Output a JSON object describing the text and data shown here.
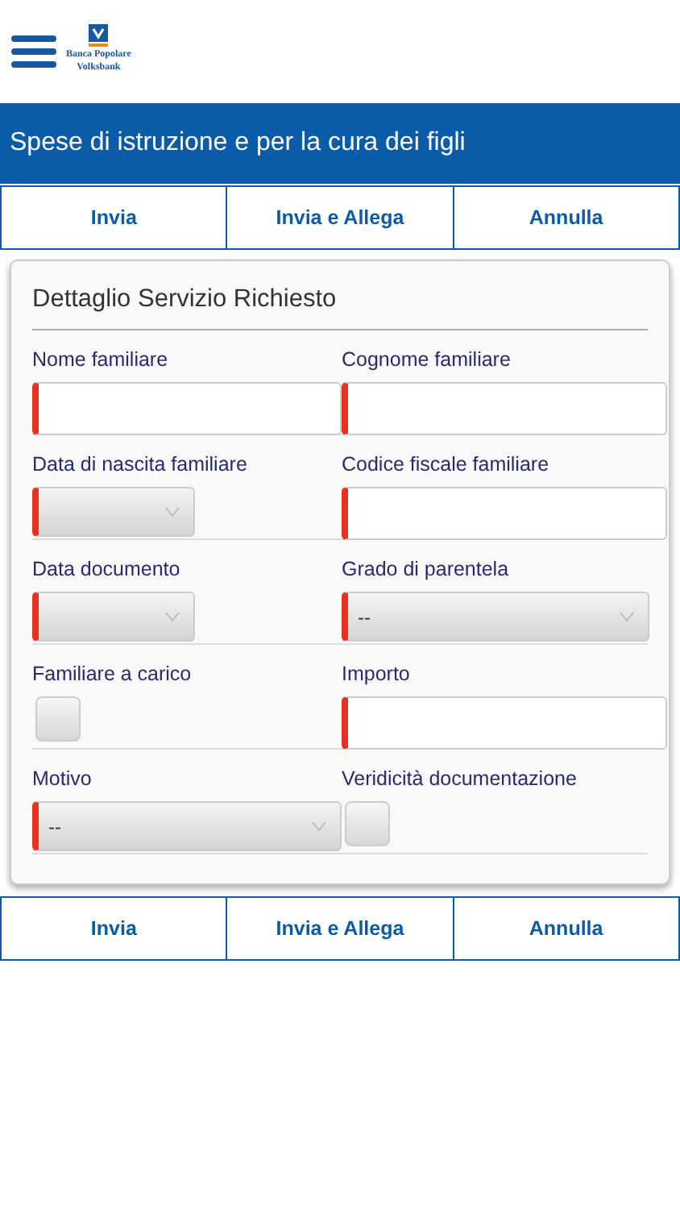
{
  "header": {
    "logo_text": [
      "Banca Popolare",
      "Volksbank"
    ]
  },
  "title": "Spese di istruzione e per la cura dei figli",
  "top_actions": [
    "Invia",
    "Invia e Allega",
    "Annulla"
  ],
  "card": {
    "title": "Dettaglio Servizio Richiesto",
    "rows": [
      [
        {
          "kind": "text",
          "label": "Nome familiare"
        },
        {
          "kind": "text",
          "label": "Cognome familiare"
        }
      ],
      [
        {
          "kind": "date",
          "label": "Data di nascita familiare"
        },
        {
          "kind": "text",
          "label": "Codice fiscale familiare"
        }
      ],
      [
        {
          "kind": "date",
          "label": "Data documento"
        },
        {
          "kind": "select",
          "label": "Grado di parentela",
          "value": "--"
        }
      ],
      [
        {
          "kind": "checkbox",
          "label": "Familiare a carico",
          "checked": false
        },
        {
          "kind": "text",
          "label": "Importo"
        }
      ],
      [
        {
          "kind": "select",
          "label": "Motivo",
          "value": "--"
        },
        {
          "kind": "checkbox",
          "label": "Veridicità documentazione",
          "checked": false
        }
      ]
    ]
  },
  "bottom_actions": [
    "Invia",
    "Invia e Allega",
    "Annulla"
  ]
}
